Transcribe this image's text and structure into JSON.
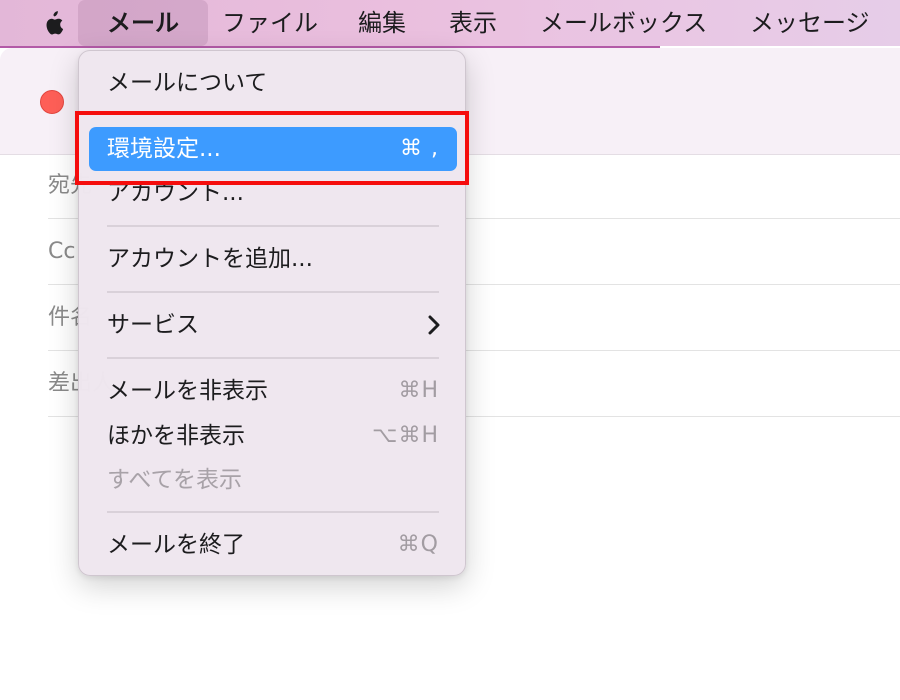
{
  "menubar": {
    "items": [
      {
        "label": "メール",
        "active": true
      },
      {
        "label": "ファイル"
      },
      {
        "label": "編集"
      },
      {
        "label": "表示"
      },
      {
        "label": "メールボックス"
      },
      {
        "label": "メッセージ"
      }
    ],
    "icons": {
      "apple": "apple-logo-icon"
    },
    "background_color": "#e6bfe0"
  },
  "window": {
    "fields": [
      {
        "label": "宛先"
      },
      {
        "label": "Cc"
      },
      {
        "label": "件名"
      },
      {
        "label": "差出人"
      }
    ]
  },
  "menu": {
    "items": [
      {
        "label": "メールについて",
        "shortcut": ""
      },
      {
        "label": "環境設定...",
        "shortcut": "⌘ ,",
        "highlighted": true
      },
      {
        "label": "アカウント...",
        "shortcut": ""
      },
      {
        "label": "アカウントを追加...",
        "shortcut": ""
      },
      {
        "label": "サービス",
        "submenu": true
      },
      {
        "label": "メールを非表示",
        "shortcut": "⌘H"
      },
      {
        "label": "ほかを非表示",
        "shortcut": "⌥⌘H"
      },
      {
        "label": "すべてを表示",
        "shortcut": "",
        "disabled": true
      },
      {
        "label": "メールを終了",
        "shortcut": "⌘Q"
      }
    ],
    "highlight_color": "#3d9bff",
    "annotation_color": "#f50d0d"
  }
}
